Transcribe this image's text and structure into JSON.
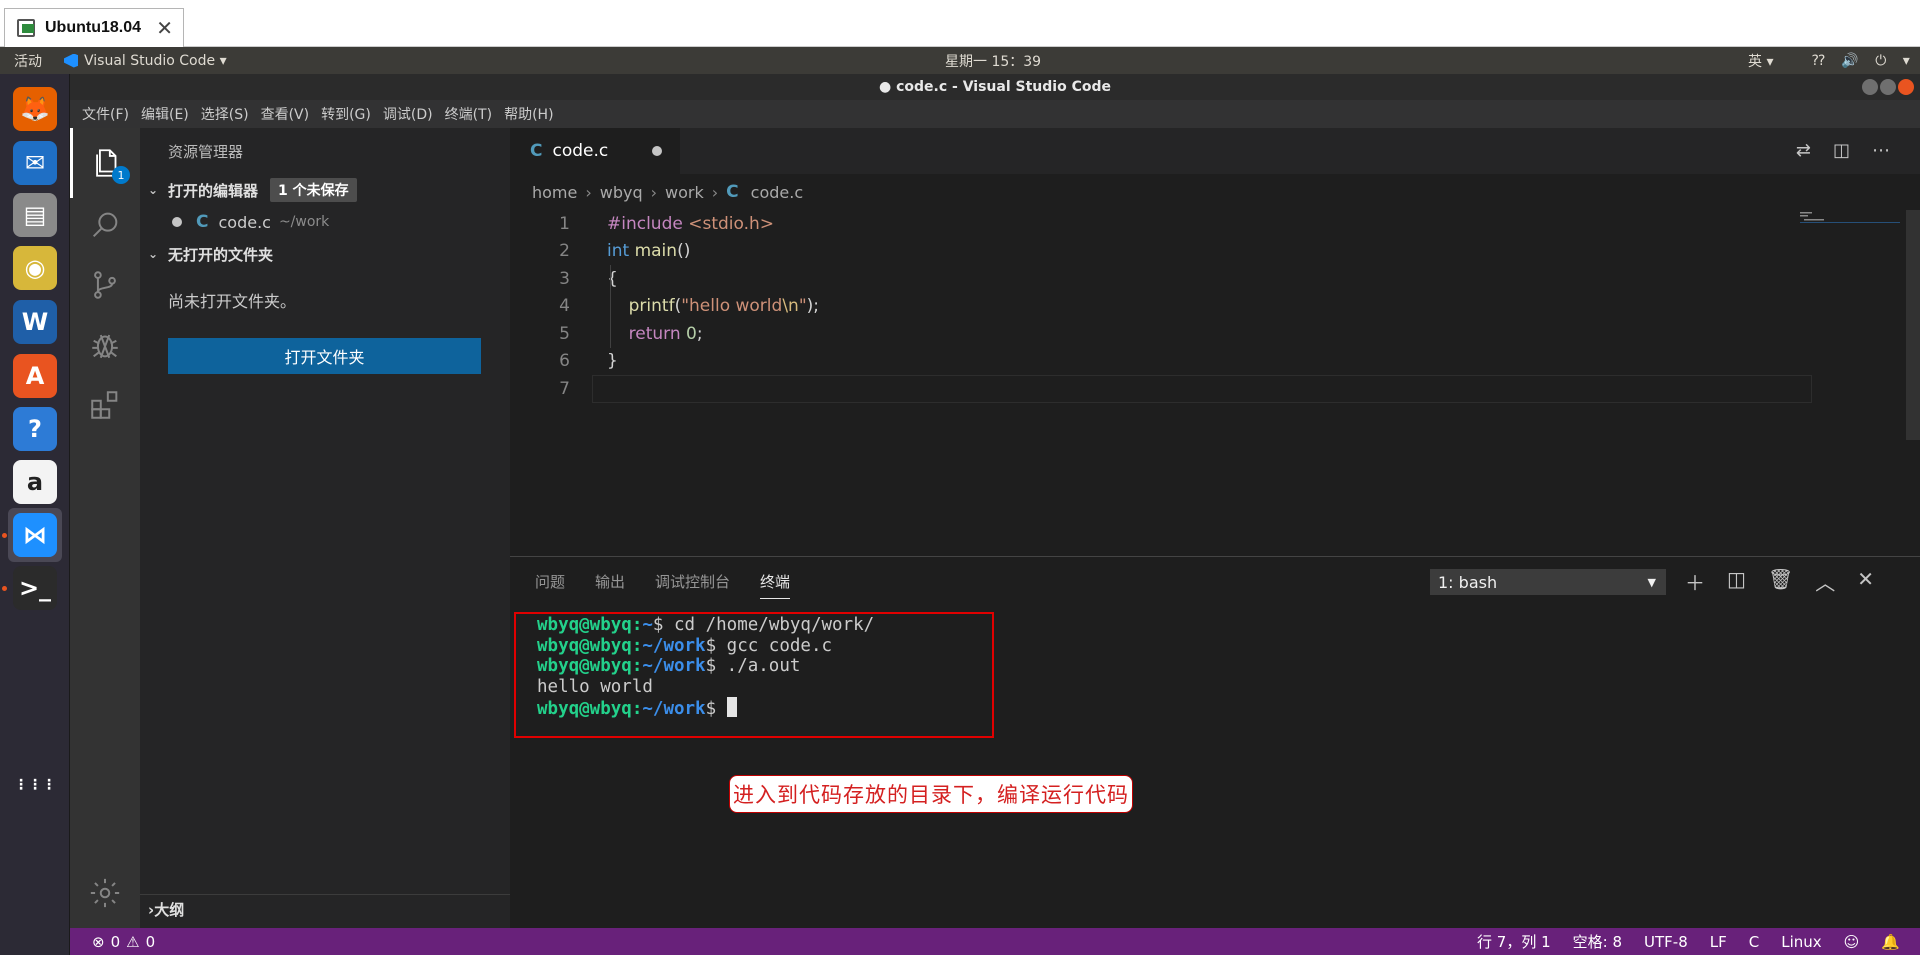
{
  "vm": {
    "tab_label": "Ubuntu18.04",
    "close": "✕"
  },
  "gnome": {
    "activities": "活动",
    "app_menu": "Visual Studio Code ▾",
    "clock": "星期一 15：39",
    "ime": "英 ▾",
    "sys": "⁇ 🔊 ⏻ ▾"
  },
  "dock": {
    "items": [
      {
        "name": "firefox-icon",
        "glyph": "🦊",
        "color": "#e66000"
      },
      {
        "name": "thunderbird-icon",
        "glyph": "✉",
        "color": "#1f6fc5"
      },
      {
        "name": "files-icon",
        "glyph": "▤",
        "color": "#8a8a8a"
      },
      {
        "name": "rhythmbox-icon",
        "glyph": "◉",
        "color": "#d7b73a"
      },
      {
        "name": "writer-icon",
        "glyph": "W",
        "color": "#1f5fa8"
      },
      {
        "name": "software-icon",
        "glyph": "A",
        "color": "#e95420"
      },
      {
        "name": "help-icon",
        "glyph": "?",
        "color": "#2d7bd6"
      },
      {
        "name": "amazon-icon",
        "glyph": "a",
        "color": "#f3f3f3"
      },
      {
        "name": "vscode-icon",
        "glyph": "⋈",
        "color": "#1e90ff"
      },
      {
        "name": "terminal-icon",
        "glyph": ">_",
        "color": "#2b2b2b"
      },
      {
        "name": "show-apps-icon",
        "glyph": "⋮⋮⋮",
        "color": "transparent"
      }
    ]
  },
  "window": {
    "title": "code.c - Visual Studio Code"
  },
  "menu": [
    "文件(F)",
    "编辑(E)",
    "选择(S)",
    "查看(V)",
    "转到(G)",
    "调试(D)",
    "终端(T)",
    "帮助(H)"
  ],
  "activity": {
    "badge": "1"
  },
  "sidebar": {
    "title": "资源管理器",
    "open_editors": "打开的编辑器",
    "unsaved": "1 个未保存",
    "file_name": "code.c",
    "file_path": "~/work",
    "c_glyph": "C",
    "no_folder_section": "无打开的文件夹",
    "no_folder_msg": "尚未打开文件夹。",
    "open_folder_btn": "打开文件夹",
    "outline": "大纲"
  },
  "editor": {
    "tab_label": "code.c",
    "breadcrumbs": [
      "home",
      "wbyq",
      "work",
      "code.c"
    ],
    "lines": [
      {
        "n": "1",
        "segments": [
          {
            "t": "#include ",
            "c": "#c586c0"
          },
          {
            "t": "<stdio.h>",
            "c": "#ce9178"
          }
        ]
      },
      {
        "n": "2",
        "segments": [
          {
            "t": "int ",
            "c": "#569cd6"
          },
          {
            "t": "main",
            "c": "#dcdcaa"
          },
          {
            "t": "()",
            "c": "#d4d4d4"
          }
        ]
      },
      {
        "n": "3",
        "segments": [
          {
            "t": "{",
            "c": "#d4d4d4"
          }
        ]
      },
      {
        "n": "4",
        "segments": [
          {
            "t": "    ",
            "c": "#d4d4d4"
          },
          {
            "t": "printf",
            "c": "#dcdcaa"
          },
          {
            "t": "(",
            "c": "#d4d4d4"
          },
          {
            "t": "\"hello world",
            "c": "#ce9178"
          },
          {
            "t": "\\n",
            "c": "#d7ba7d"
          },
          {
            "t": "\"",
            "c": "#ce9178"
          },
          {
            "t": ");",
            "c": "#d4d4d4"
          }
        ]
      },
      {
        "n": "5",
        "segments": [
          {
            "t": "    ",
            "c": "#d4d4d4"
          },
          {
            "t": "return ",
            "c": "#c586c0"
          },
          {
            "t": "0",
            "c": "#b5cea8"
          },
          {
            "t": ";",
            "c": "#d4d4d4"
          }
        ]
      },
      {
        "n": "6",
        "segments": [
          {
            "t": "}",
            "c": "#d4d4d4"
          }
        ]
      },
      {
        "n": "7",
        "segments": []
      }
    ]
  },
  "panel": {
    "tabs": [
      "问题",
      "输出",
      "调试控制台",
      "终端"
    ],
    "terminal_select": "1: bash",
    "terminal_lines": [
      {
        "user": "wbyq@wbyq",
        "path": "~",
        "cmd": "$ cd /home/wbyq/work/"
      },
      {
        "user": "wbyq@wbyq",
        "path": "~/work",
        "cmd": "$ gcc code.c"
      },
      {
        "user": "wbyq@wbyq",
        "path": "~/work",
        "cmd": "$ ./a.out"
      },
      {
        "output": "hello world"
      },
      {
        "user": "wbyq@wbyq",
        "path": "~/work",
        "cmd": "$ ",
        "cursor": true
      }
    ],
    "callout": "进入到代码存放的目录下，编译运行代码"
  },
  "status": {
    "errors": "0",
    "warnings": "0",
    "position": "行 7，列 1",
    "spaces": "空格: 8",
    "encoding": "UTF-8",
    "eol": "LF",
    "language": "C",
    "platform": "Linux"
  },
  "colors": {
    "statusbar": "#68217a",
    "accent": "#007acc",
    "highlight_box": "#e00000"
  }
}
